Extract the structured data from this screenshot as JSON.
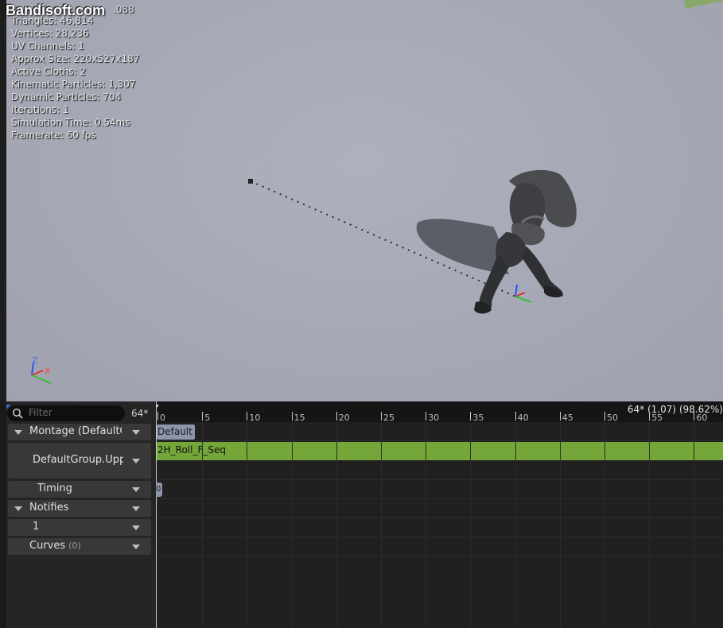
{
  "watermark": "Bandisoft.com",
  "stats_fragment": ".088",
  "stats": [
    "Triangles: 46,814",
    "Vertices: 28,236",
    "UV Channels: 1",
    "Approx Size: 220x527x187",
    "Active Cloths: 2",
    "Kinematic Particles: 1,307",
    "Dynamic Particles: 704",
    "Iterations: 1",
    "Simulation Time: 0.54ms",
    "Framerate: 60 fps"
  ],
  "axis_widget": {
    "z": "Z",
    "x": "X"
  },
  "filter": {
    "placeholder": "Filter",
    "frame_count": "64*"
  },
  "tracks": {
    "montage": "Montage (DefaultGroup)",
    "slot": "DefaultGroup.UpperBody",
    "timing": "Timing",
    "notifies": "Notifies",
    "notify_track": "1",
    "curves": "Curves",
    "curves_count": "(0)"
  },
  "timeline": {
    "info": "64* (1.07) (98.62%)",
    "ticks": [
      "0",
      "5",
      "10",
      "15",
      "20",
      "25",
      "30",
      "35",
      "40",
      "45",
      "50",
      "55",
      "60"
    ],
    "section_label": "Default",
    "sequence_label": "2H_Roll_F_Seq",
    "timing_chip": "0"
  },
  "colors": {
    "viewport_bg": "#a7aab6",
    "sequence_bar": "#74a63a",
    "section_chip": "#8c96aa",
    "axis_x": "#e03030",
    "axis_y": "#30c030",
    "axis_z": "#3050ff"
  }
}
